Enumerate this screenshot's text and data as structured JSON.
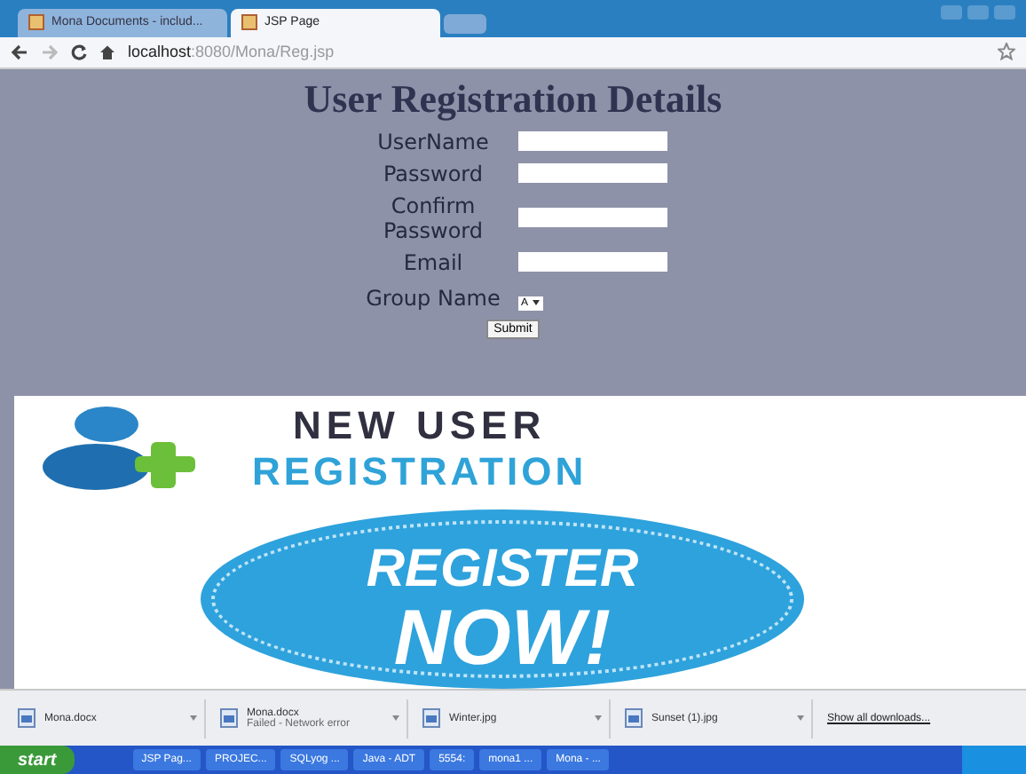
{
  "browser": {
    "tabs": [
      {
        "label": "Mona Documents - includ...",
        "selected": false
      },
      {
        "label": "JSP Page",
        "selected": true
      }
    ],
    "address": {
      "host": "localhost",
      "path": ":8080/Mona/Reg.jsp"
    }
  },
  "page": {
    "heading": "User Registration Details",
    "fields": [
      {
        "label": "UserName",
        "kind": "text"
      },
      {
        "label": "Password",
        "kind": "text"
      },
      {
        "label": "Confirm Password",
        "kind": "text"
      },
      {
        "label": "Email",
        "kind": "text"
      },
      {
        "label": "Group Name",
        "kind": "select",
        "value": "A"
      }
    ],
    "submit": "Submit",
    "banner": {
      "line1": "NEW USER",
      "line2": "REGISTRATION"
    },
    "badge": {
      "line1": "REGISTER",
      "line2": "NOW!"
    }
  },
  "downloads": {
    "items": [
      {
        "name": "Mona.docx"
      },
      {
        "name": "Mona.docx",
        "status": "Failed - Network error"
      },
      {
        "name": "Winter.jpg"
      },
      {
        "name": "Sunset (1).jpg"
      }
    ],
    "show_all": "Show all downloads..."
  },
  "taskbar": {
    "start": "start",
    "items": [
      "JSP Pag...",
      "PROJEC...",
      "SQLyog ...",
      "Java - ADT",
      "5554:",
      "mona1 ...",
      "Mona - ..."
    ]
  }
}
